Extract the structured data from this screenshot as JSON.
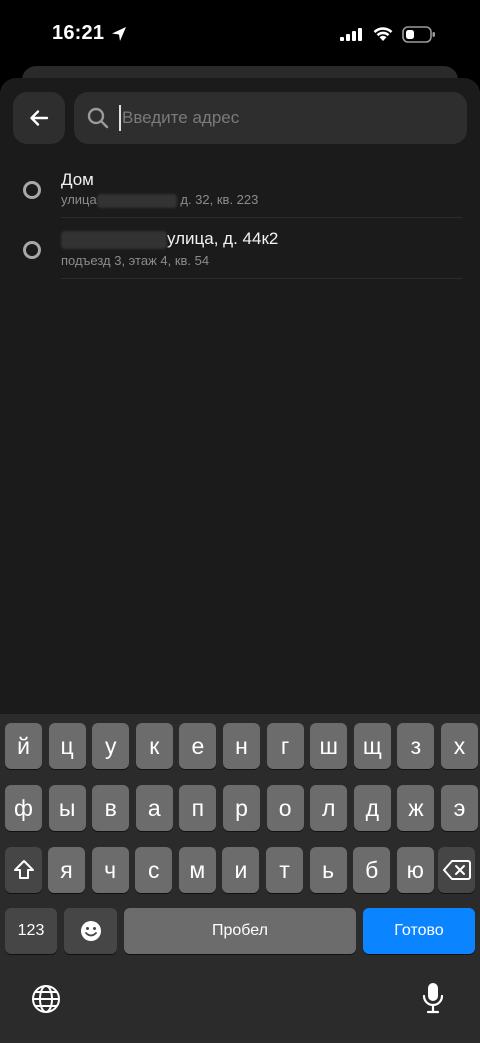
{
  "status_bar": {
    "time": "16:21"
  },
  "search": {
    "placeholder": "Введите адрес",
    "value": ""
  },
  "addresses": [
    {
      "title": "Дом",
      "subtitle_prefix": "улица",
      "subtitle_suffix": "д. 32, кв. 223"
    },
    {
      "title_suffix": "улица, д. 44к2",
      "subtitle": "подъезд 3, этаж 4, кв. 54"
    }
  ],
  "keyboard": {
    "row1": [
      "й",
      "ц",
      "у",
      "к",
      "е",
      "н",
      "г",
      "ш",
      "щ",
      "з",
      "х"
    ],
    "row2": [
      "ф",
      "ы",
      "в",
      "а",
      "п",
      "р",
      "о",
      "л",
      "д",
      "ж",
      "э"
    ],
    "row3": [
      "я",
      "ч",
      "с",
      "м",
      "и",
      "т",
      "ь",
      "б",
      "ю"
    ],
    "numbers_label": "123",
    "space_label": "Пробел",
    "done_label": "Готово"
  },
  "colors": {
    "accent": "#0a84ff",
    "sheet": "#1b1b1b",
    "key": "#6c6c6c",
    "key_fn": "#464646"
  }
}
